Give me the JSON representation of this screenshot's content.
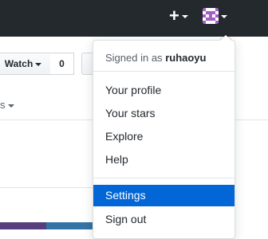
{
  "header": {
    "plus_label": "+",
    "plus_icon": "plus-icon",
    "caret_icon": "triangle-down-icon",
    "avatar_icon": "identicon-avatar",
    "background": "#24292e"
  },
  "repo": {
    "watch_label": "Watch",
    "watch_count": "0",
    "tab_fragment": "s",
    "language_colors": [
      "#563d7c",
      "#3572a5",
      "#e34c26"
    ]
  },
  "dropdown": {
    "signed_in_prefix": "Signed in as",
    "username": "ruhaoyu",
    "items": [
      {
        "label": "Your profile"
      },
      {
        "label": "Your stars"
      },
      {
        "label": "Explore"
      },
      {
        "label": "Help"
      },
      {
        "label": "Settings",
        "active": true
      },
      {
        "label": "Sign out"
      }
    ],
    "active_color": "#0366d6"
  }
}
